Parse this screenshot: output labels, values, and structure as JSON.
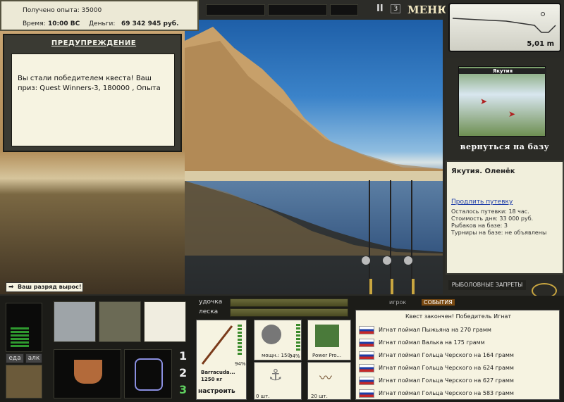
{
  "top_info": {
    "experience": "Получено опыта: 35000",
    "time_label": "Время:",
    "time_value": "10:00 ВС",
    "money_label": "Деньги:",
    "money_value": "69 342 945 руб."
  },
  "top_bar": {
    "menu_label": "МЕНЮ",
    "speed_label": "3",
    "pause_label": "II"
  },
  "warning": {
    "title": "ПРЕДУПРЕЖДЕНИЕ",
    "message": "Вы стали победителем квеста! Ваш приз: Quest Winners-3, 180000 , Опыта"
  },
  "rank_message": "Ваш разряд вырос!",
  "depth": {
    "value": "5,01 m"
  },
  "map": {
    "thumb_title": "Якутия",
    "back_label": "вернуться на базу"
  },
  "location": {
    "name": "Якутия. Оленёк",
    "extend_link": "Продлить путевку",
    "lines": [
      "Осталось путевки: 18 час.",
      "Стоимость дня: 33 000 руб.",
      "Рыбаков на базе: 3",
      "Турниры на базе: не объявлены"
    ]
  },
  "bans_label": "РЫБОЛОВНЫЕ ЗАПРЕТЫ",
  "bottom": {
    "food_label": "еда",
    "alc_label": "алк",
    "rod_label": "удочка",
    "line_label": "леска",
    "slots": [
      "1",
      "2",
      "3"
    ],
    "rod_name": "Barracuda...",
    "rod_weight": "1250 кг",
    "rod_percent": "94%",
    "reel_power": "мощн.: 150",
    "reel_percent": "94%",
    "lure_name": "Power Pro...",
    "hook_count": "0 шт.",
    "bait_count": "20 шт.",
    "setup_label": "настроить"
  },
  "events": {
    "tab_player": "игрок",
    "tab_events": "СОБЫТИЯ",
    "title": "Квест закончен! Победитель Игнат",
    "rows": [
      "Игнат поймал Пыжьяна на 270 грамм",
      "Игнат поймал Валька на 175 грамм",
      "Игнат поймал Гольца Черского на 164 грамм",
      "Игнат поймал Гольца Черского на 624 грамм",
      "Игнат поймал Гольца Черского на 627 грамм",
      "Игнат поймал Гольца Черского на 583 грамм"
    ]
  },
  "colors": {
    "accent": "#f0e6c0",
    "panel": "#f4f1df",
    "link": "#1b3aa8"
  }
}
